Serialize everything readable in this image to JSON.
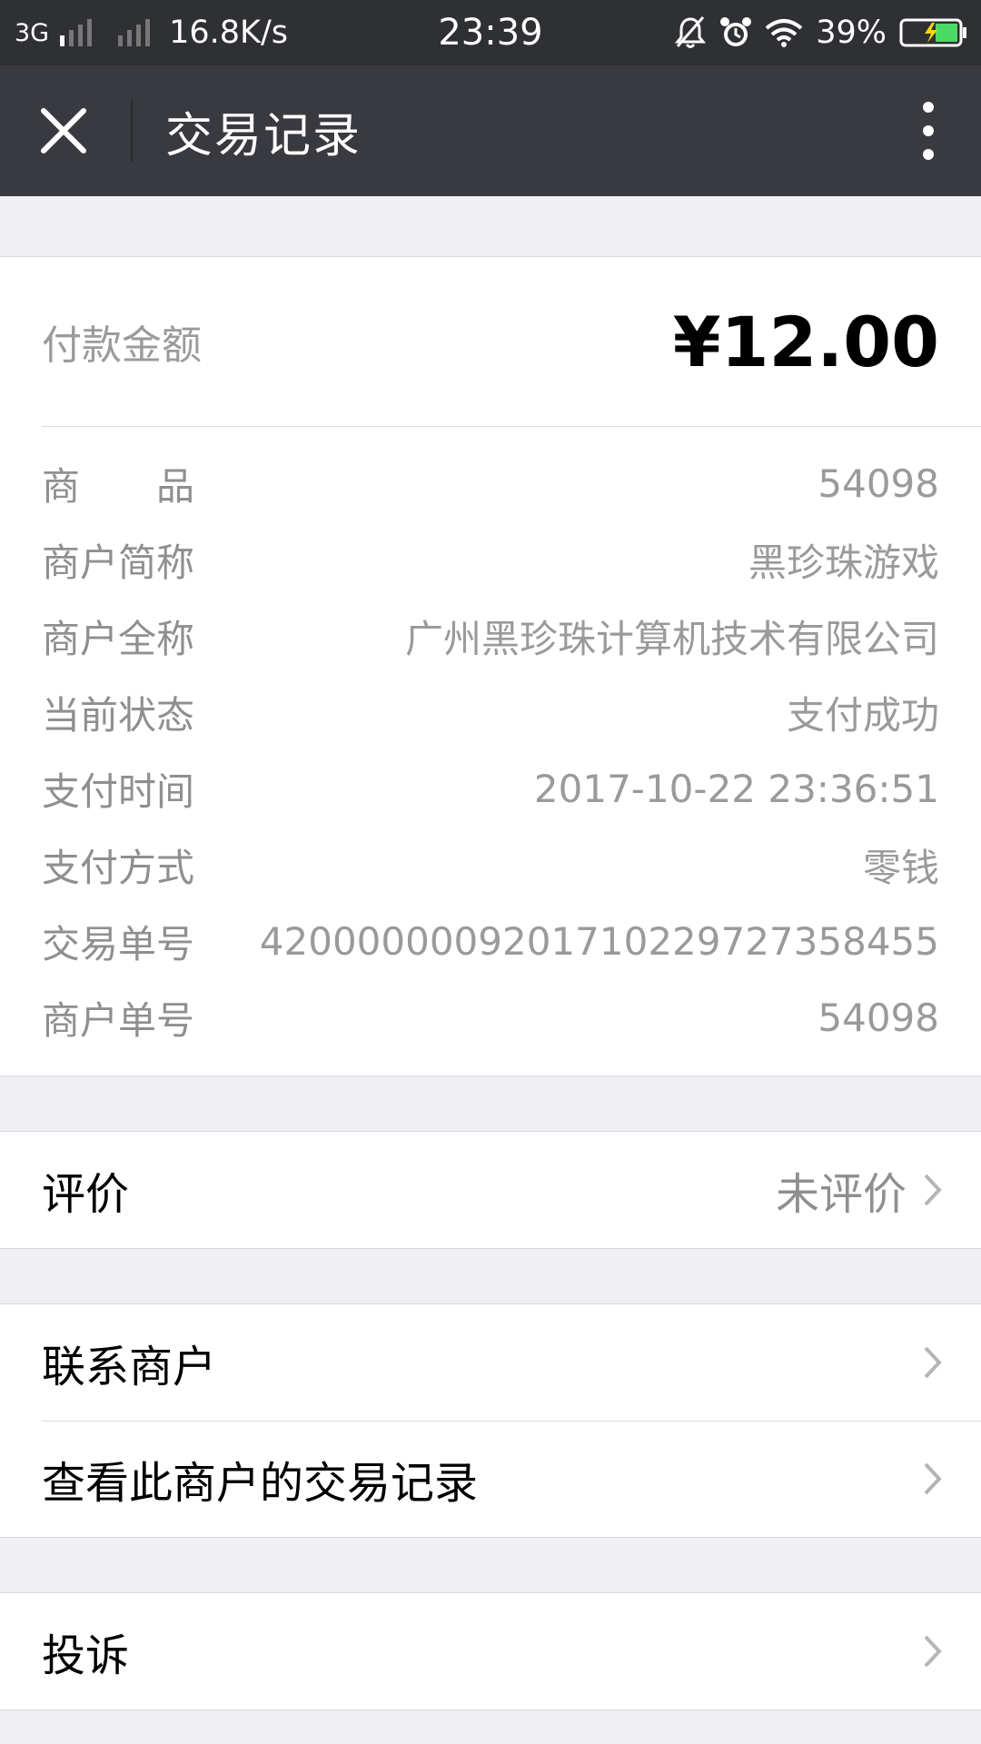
{
  "status_bar": {
    "network": "3G",
    "speed": "16.8K/s",
    "time": "23:39",
    "battery": "39%"
  },
  "nav": {
    "title": "交易记录"
  },
  "payment": {
    "amount_label": "付款金额",
    "amount": "¥12.00"
  },
  "details": [
    {
      "label": "商　　品",
      "value": "54098"
    },
    {
      "label": "商户简称",
      "value": "黑珍珠游戏"
    },
    {
      "label": "商户全称",
      "value": "广州黑珍珠计算机技术有限公司"
    },
    {
      "label": "当前状态",
      "value": "支付成功"
    },
    {
      "label": "支付时间",
      "value": "2017-10-22 23:36:51"
    },
    {
      "label": "支付方式",
      "value": "零钱"
    },
    {
      "label": "交易单号",
      "value": "4200000009201710229727358455"
    },
    {
      "label": "商户单号",
      "value": "54098"
    }
  ],
  "rating": {
    "label": "评价",
    "value": "未评价"
  },
  "merchant_menu": [
    {
      "label": "联系商户"
    },
    {
      "label": "查看此商户的交易记录"
    }
  ],
  "complaint": {
    "label": "投诉"
  },
  "colors": {
    "status_bar_bg": "#2e3033",
    "nav_bg": "#393a3f",
    "page_bg": "#efeff4",
    "card_bg": "#ffffff",
    "label_gray": "#8f8f8f"
  },
  "icons": [
    "close-icon",
    "more-vertical-icon",
    "chevron-right-icon",
    "bell-off-icon",
    "alarm-icon",
    "wifi-icon",
    "battery-charging-icon"
  ]
}
